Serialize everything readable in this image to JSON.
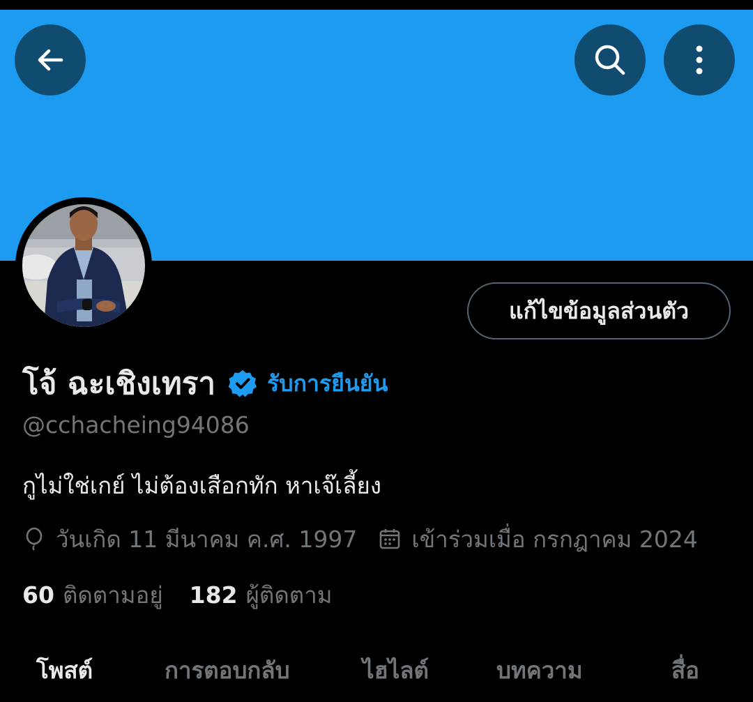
{
  "header": {
    "back_icon": "arrow-left-icon",
    "search_icon": "search-icon",
    "more_icon": "more-vertical-icon",
    "banner_color": "#1d9bf0"
  },
  "profile": {
    "edit_button_label": "แก้ไขข้อมูลส่วนตัว",
    "display_name": "โจ้ ฉะเชิงเทรา",
    "verify_label": "รับการยืนยัน",
    "handle": "@cchacheing94086",
    "bio": "กูไม่ใช่เกย์ ไม่ต้องเสือกทัก หาเจ๊เลี้ยง",
    "birthday": "วันเกิด 11 มีนาคม ค.ศ. 1997",
    "joined": "เข้าร่วมเมื่อ กรกฎาคม 2024",
    "following_count": "60",
    "following_label": "ติดตามอยู่",
    "followers_count": "182",
    "followers_label": "ผู้ติดตาม"
  },
  "tabs": [
    {
      "label": "โพสต์",
      "active": true
    },
    {
      "label": "การตอบกลับ",
      "active": false
    },
    {
      "label": "ไฮไลต์",
      "active": false
    },
    {
      "label": "บทความ",
      "active": false
    },
    {
      "label": "สื่อ",
      "active": false
    }
  ],
  "colors": {
    "accent": "#1d9bf0",
    "background": "#000000",
    "primary_text": "#e7e9ea",
    "secondary_text": "#71767b"
  }
}
